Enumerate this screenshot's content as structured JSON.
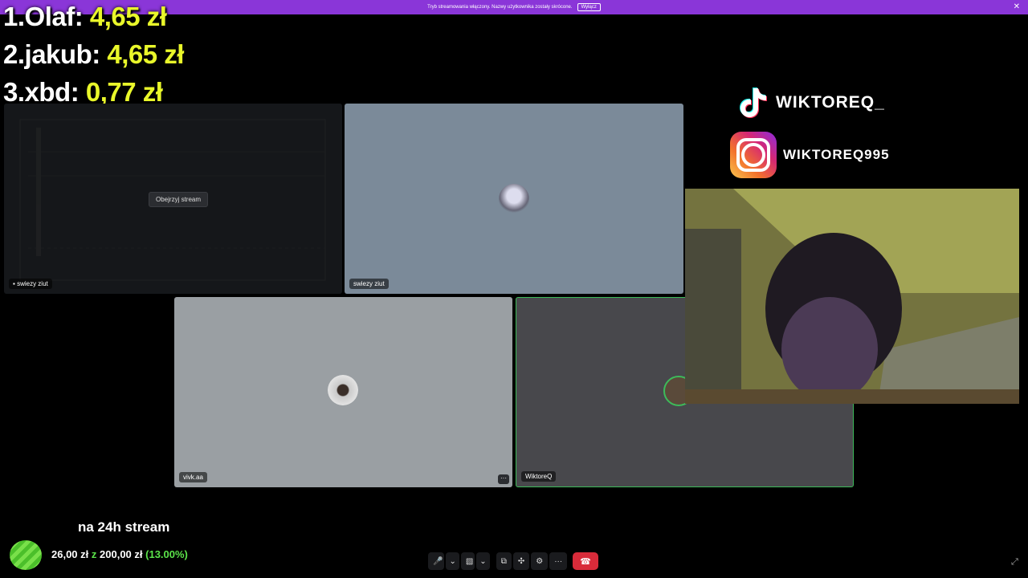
{
  "topbar": {
    "message": "Tryb streamowania włączony. Nazwy użytkownika zostały skrócone.",
    "disable_label": "Wyłącz",
    "close_glyph": "✕"
  },
  "leaderboard": [
    {
      "rank": "1.",
      "name": "Olaf:",
      "amount": "4,65 zł"
    },
    {
      "rank": "2.",
      "name": "jakub:",
      "amount": "4,65 zł"
    },
    {
      "rank": "3.",
      "name": "xbd:",
      "amount": "0,77 zł"
    }
  ],
  "tiles": {
    "t1": {
      "name": "swiezy ziut",
      "watch_label": "Obejrzyj stream"
    },
    "t2": {
      "name": "swiezy ziut"
    },
    "t3": {
      "name": "vivk.aa",
      "more": "···"
    },
    "t4": {
      "name": "WiktoreQ"
    }
  },
  "socials": {
    "tiktok": "WIKTOREQ_",
    "instagram": "WIKTOREQ995"
  },
  "goal": {
    "title": "na 24h stream",
    "current": "26,00 zł",
    "of": "z",
    "target": "200,00 zł",
    "percent": "(13.00%)",
    "progress_fraction": 0.13
  },
  "controls": {
    "mic": "🎤",
    "mic_menu": "⌄",
    "camera": "▧",
    "camera_menu": "⌄",
    "screen_share": "⧉",
    "activities": "✣",
    "soundboard": "⚙",
    "more": "···",
    "hangup": "☎",
    "fullscreen": "⤢"
  },
  "colors": {
    "topbar": "#8a36d8",
    "amount_yellow": "#e9f72a",
    "speaking_border": "#3dbb5a",
    "hangup_red": "#d92b3a",
    "percent_green": "#5be34a"
  },
  "icons": [
    "tiktok-icon",
    "instagram-icon",
    "microphone-icon",
    "camera-icon",
    "screen-share-icon",
    "hangup-icon",
    "fullscreen-icon"
  ]
}
